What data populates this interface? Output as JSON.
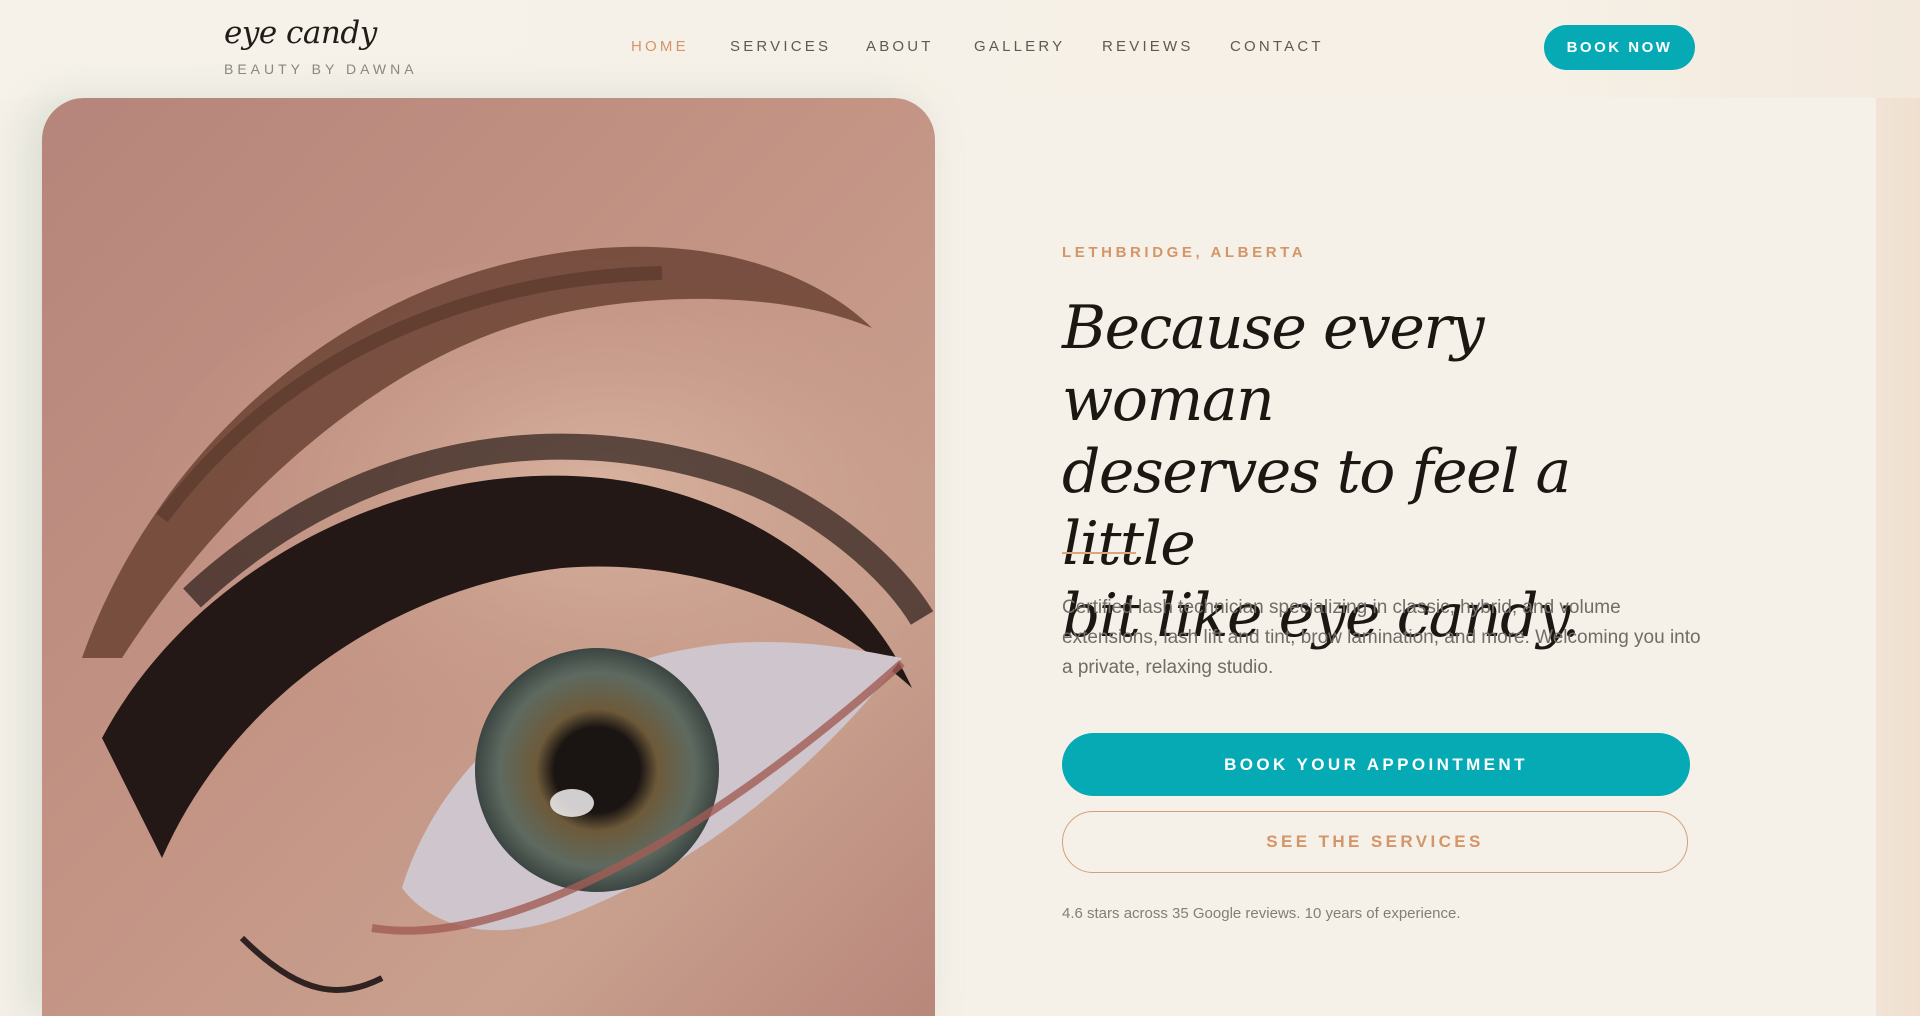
{
  "brand": {
    "name": "eye candy",
    "subtitle": "BEAUTY BY DAWNA"
  },
  "nav": {
    "items": [
      {
        "label": "HOME",
        "active": true
      },
      {
        "label": "SERVICES",
        "active": false
      },
      {
        "label": "ABOUT",
        "active": false
      },
      {
        "label": "GALLERY",
        "active": false
      },
      {
        "label": "REVIEWS",
        "active": false
      },
      {
        "label": "CONTACT",
        "active": false
      }
    ],
    "book_label": "BOOK NOW"
  },
  "hero": {
    "kicker": "LETHBRIDGE, ALBERTA",
    "headline_lines": [
      "Because every woman",
      "deserves to feel a little",
      "bit like eye candy."
    ],
    "description": "Certified lash technician specializing in classic, hybrid, and volume extensions, lash lift and tint, brow lamination, and more. Welcoming you into a private, relaxing studio.",
    "primary_cta": "BOOK YOUR APPOINTMENT",
    "secondary_cta": "SEE THE SERVICES",
    "footnote": "4.6 stars across 35 Google reviews. 10 years of experience."
  },
  "colors": {
    "accent_teal": "#06aab5",
    "accent_peach": "#d49568",
    "background": "#f5f0e8",
    "text_dark": "#1b1814"
  }
}
